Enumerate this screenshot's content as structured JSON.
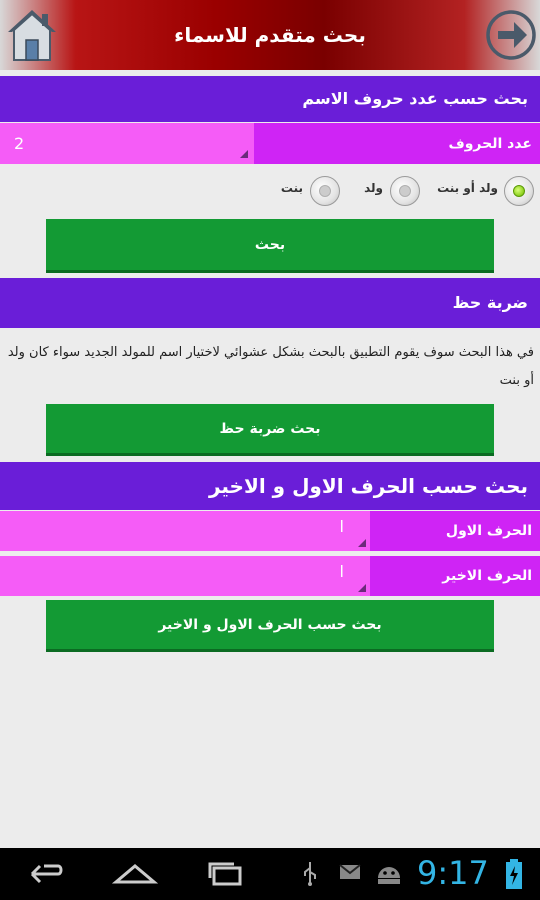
{
  "header": {
    "title": "بحث متقدم للاسماء",
    "home_icon": "home-icon",
    "back_icon": "arrow-right-circle-icon",
    "accent_color": "#9a0000"
  },
  "section_letters_count": {
    "title": "بحث حسب عدد حروف الاسم",
    "field_label": "عدد الحروف",
    "field_value": "2",
    "radios": [
      {
        "label": "ولد أو بنت",
        "selected": true
      },
      {
        "label": "ولد",
        "selected": false
      },
      {
        "label": "بنت",
        "selected": false
      }
    ],
    "search_button": "بحث"
  },
  "section_luck": {
    "title": "ضربة حظ",
    "description": "في هذا البحث سوف يقوم التطبيق بالبحث بشكل عشوائي لاختيار اسم للمولد الجديد سواء كان ولد أو بنت",
    "button": "بحث ضربة حظ"
  },
  "section_first_last": {
    "title": "بحث حسب الحرف الاول و الاخير",
    "first_label": "الحرف الاول",
    "first_value": "ا",
    "last_label": "الحرف الاخير",
    "last_value": "ا",
    "button": "بحث حسب الحرف الاول و الاخير"
  },
  "system_bar": {
    "clock": "9:17",
    "accent_color": "#33b5e5",
    "nav_icons": [
      "back-icon",
      "home-icon",
      "recent-apps-icon"
    ],
    "status_icons": [
      "usb-icon",
      "gmail-icon",
      "android-debug-icon",
      "battery-charging-icon"
    ]
  }
}
